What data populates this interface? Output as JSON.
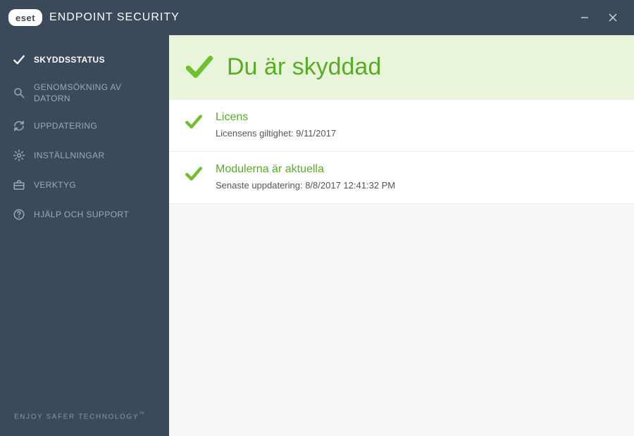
{
  "brand": {
    "badge": "eset",
    "product": "ENDPOINT SECURITY"
  },
  "sidebar": {
    "items": [
      {
        "label": "SKYDDSSTATUS"
      },
      {
        "label": "GENOMSÖKNING AV DATORN"
      },
      {
        "label": "UPPDATERING"
      },
      {
        "label": "INSTÄLLNINGAR"
      },
      {
        "label": "VERKTYG"
      },
      {
        "label": "HJÄLP OCH SUPPORT"
      }
    ],
    "footer": "ENJOY SAFER TECHNOLOGY",
    "footer_tm": "™"
  },
  "banner": {
    "title": "Du är skyddad"
  },
  "cards": [
    {
      "title": "Licens",
      "subtitle": "Licensens giltighet: 9/11/2017"
    },
    {
      "title": "Modulerna är aktuella",
      "subtitle": "Senaste uppdatering: 8/8/2017 12:41:32 PM"
    }
  ]
}
